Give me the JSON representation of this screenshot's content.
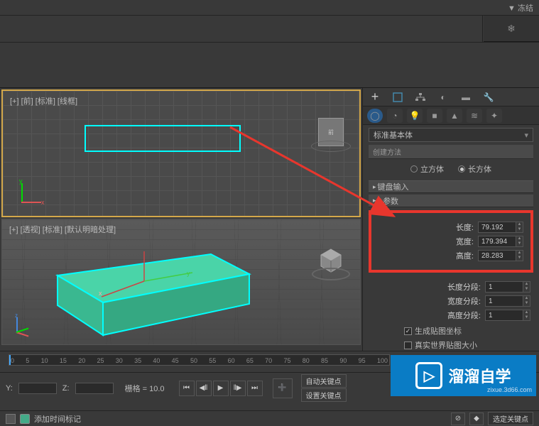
{
  "topbar": {
    "freeze": "▼ 冻结"
  },
  "viewports": {
    "front": {
      "label": "[+] [前] [标准] [线框]"
    },
    "persp": {
      "label": "[+] [透视] [标准] [默认明暗处理]"
    }
  },
  "panel": {
    "dropdown": "标准基本体",
    "creation_hdr": "创建方法",
    "shape_radio": {
      "cube": "立方体",
      "cuboid": "长方体"
    },
    "keyboard_hdr": "键盘输入",
    "params_hdr": "参数",
    "length": {
      "label": "长度:",
      "value": "79.192"
    },
    "width": {
      "label": "宽度:",
      "value": "179.394"
    },
    "height": {
      "label": "高度:",
      "value": "28.283"
    },
    "len_seg": {
      "label": "长度分段:",
      "value": "1"
    },
    "wid_seg": {
      "label": "宽度分段:",
      "value": "1"
    },
    "hgt_seg": {
      "label": "高度分段:",
      "value": "1"
    },
    "gen_map": "生成贴图坐标",
    "real_world": "真实世界贴图大小"
  },
  "timeline": {
    "ticks": [
      "0",
      "5",
      "10",
      "15",
      "20",
      "25",
      "30",
      "35",
      "40",
      "45",
      "50",
      "55",
      "60",
      "65",
      "70",
      "75",
      "80",
      "85",
      "90",
      "95",
      "100"
    ]
  },
  "status": {
    "y_label": "Y:",
    "z_label": "Z:",
    "grid": "栅格 = 10.0",
    "auto_key": "自动关键点",
    "set_key": "设置关键点",
    "add_mark": "添加时间标记",
    "filter": "选定关键点"
  },
  "watermark": {
    "text": "溜溜自学",
    "url": "zixue.3d66.com"
  }
}
